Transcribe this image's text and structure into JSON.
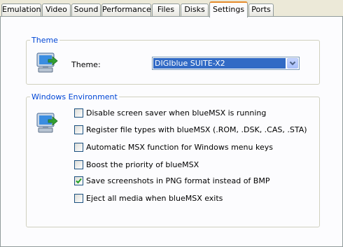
{
  "tabs": [
    "Emulation",
    "Video",
    "Sound",
    "Performance",
    "Files",
    "Disks",
    "Settings",
    "Ports"
  ],
  "active_tab": "Settings",
  "theme_group": {
    "legend": "Theme",
    "icon": "computer-settings-icon",
    "label": "Theme:",
    "selected": "DIGIblue SUITE-X2"
  },
  "windows_group": {
    "legend": "Windows Environment",
    "icon": "computer-settings-icon",
    "options": [
      {
        "label": "Disable screen saver when blueMSX is running",
        "checked": false
      },
      {
        "label": "Register file types with blueMSX (.ROM, .DSK, .CAS, .STA)",
        "checked": false
      },
      {
        "label": "Automatic MSX function for Windows menu keys",
        "checked": false
      },
      {
        "label": "Boost the priority of blueMSX",
        "checked": false
      },
      {
        "label": "Save screenshots in PNG format instead of BMP",
        "checked": true
      },
      {
        "label": "Eject all media when blueMSX exits",
        "checked": false
      }
    ]
  },
  "colors": {
    "accent": "#e68b2c",
    "legend": "#0046d5",
    "selection": "#316ac5"
  }
}
